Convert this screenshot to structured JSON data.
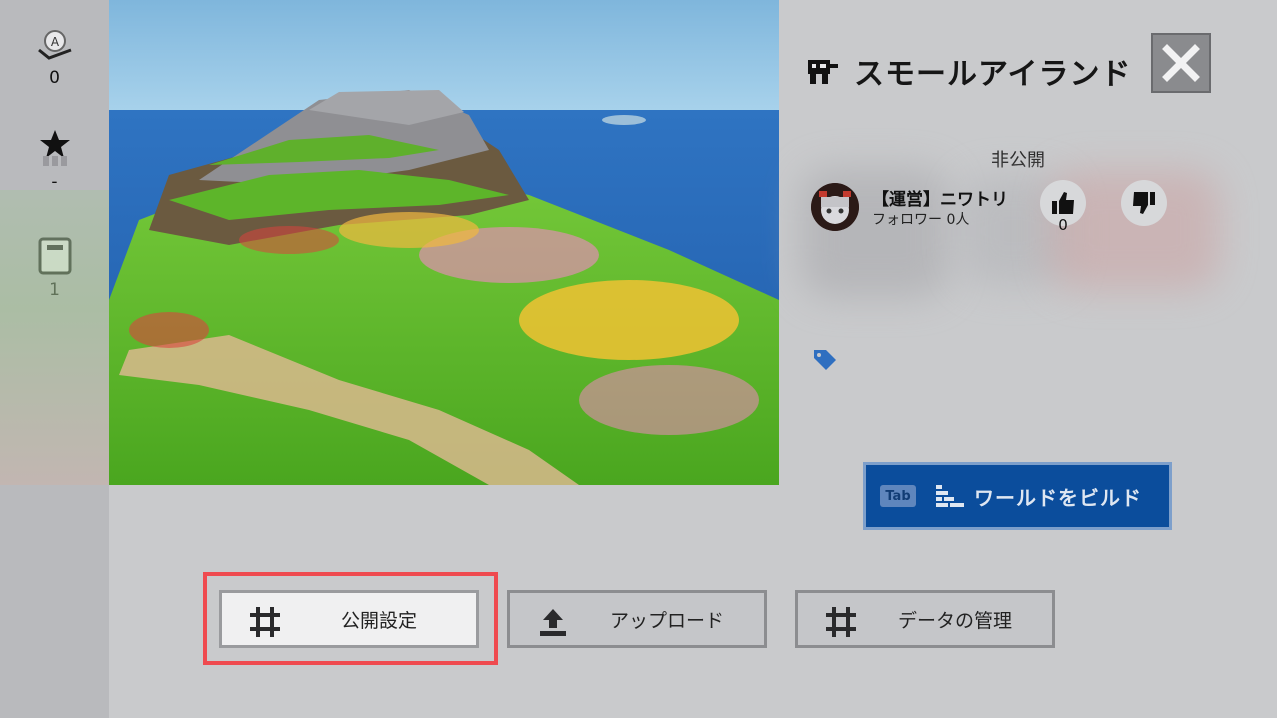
{
  "stats": {
    "play_count": "0",
    "rating": "-",
    "books": "1"
  },
  "world": {
    "title": "スモールアイランド",
    "visibility": "非公開"
  },
  "author": {
    "name": "【運営】ニワトリ",
    "followers": "フォロワー 0人"
  },
  "votes": {
    "like_count": "0"
  },
  "build": {
    "key_hint": "Tab",
    "label": "ワールドをビルド"
  },
  "actions": {
    "publish_settings": "公開設定",
    "upload": "アップロード",
    "data_management": "データの管理"
  },
  "colors": {
    "accent_blue": "#0b4d9c",
    "highlight_red": "#ef4a4f",
    "tag_blue": "#2f6fc0"
  },
  "icons": {
    "play": "play-count-icon",
    "rating": "star-rating-icon",
    "books": "book-icon",
    "world": "world-flag-icon",
    "close": "close-icon",
    "like": "thumbs-up-icon",
    "dislike": "thumbs-down-icon",
    "tag": "tag-icon",
    "bricks": "bricks-icon",
    "hash": "hash-settings-icon",
    "upload": "upload-icon"
  }
}
